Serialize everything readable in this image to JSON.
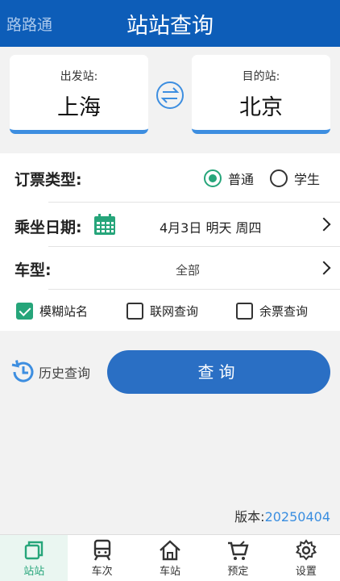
{
  "header": {
    "app_name": "路路通",
    "title": "站站查询"
  },
  "stations": {
    "from": {
      "label": "出发站:",
      "name": "上海"
    },
    "to": {
      "label": "目的站:",
      "name": "北京"
    }
  },
  "ticket_type": {
    "label": "订票类型:",
    "options": [
      "普通",
      "学生"
    ],
    "selected": "普通"
  },
  "date": {
    "label": "乘坐日期:",
    "value": "4月3日 明天 周四"
  },
  "train_type": {
    "label": "车型:",
    "value": "全部"
  },
  "checkboxes": [
    {
      "label": "模糊站名",
      "checked": true
    },
    {
      "label": "联网查询",
      "checked": false
    },
    {
      "label": "余票查询",
      "checked": false
    }
  ],
  "history_label": "历史查询",
  "query_label": "查询",
  "version": {
    "label": "版本:",
    "number": "20250404"
  },
  "tabs": [
    {
      "label": "站站",
      "icon": "station-to-station-icon",
      "active": true
    },
    {
      "label": "车次",
      "icon": "train-icon",
      "active": false
    },
    {
      "label": "车站",
      "icon": "home-station-icon",
      "active": false
    },
    {
      "label": "预定",
      "icon": "cart-icon",
      "active": false
    },
    {
      "label": "设置",
      "icon": "gear-icon",
      "active": false
    }
  ],
  "colors": {
    "header": "#0d5db8",
    "accent_green": "#26a57a",
    "button_blue": "#2a6fc4",
    "card_underline": "#3d8ee0"
  }
}
